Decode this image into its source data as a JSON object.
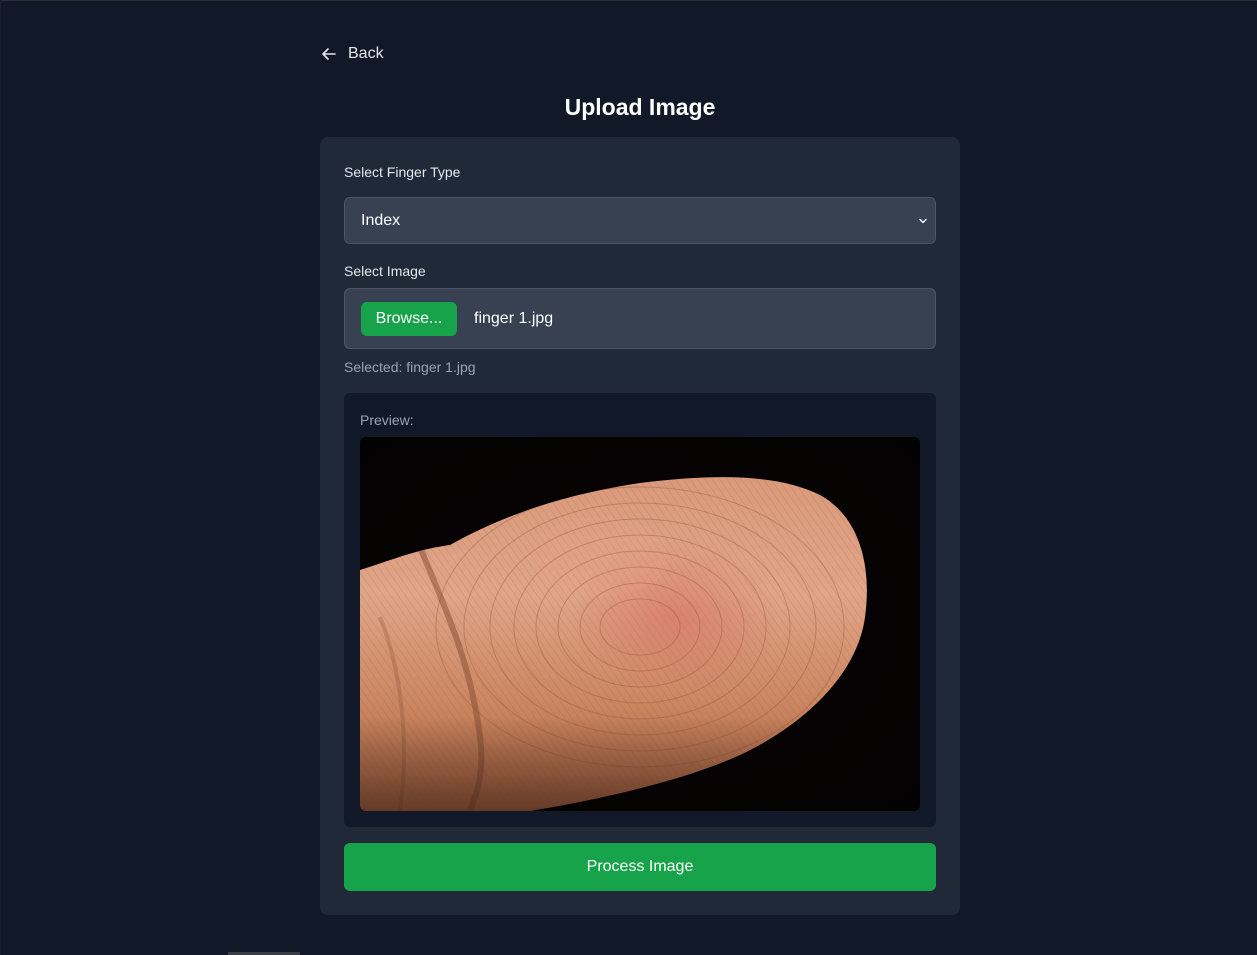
{
  "nav": {
    "back_label": "Back",
    "back_icon": "arrow-left-icon"
  },
  "page": {
    "title": "Upload Image"
  },
  "form": {
    "finger_type_label": "Select Finger Type",
    "finger_type_value": "Index",
    "select_icon": "chevron-down-icon",
    "image_label": "Select Image",
    "browse_label": "Browse...",
    "file_name": "finger 1.jpg",
    "selected_text": "Selected: finger 1.jpg",
    "preview_label": "Preview:",
    "process_label": "Process Image"
  },
  "colors": {
    "background": "#111827",
    "card": "#1f2937",
    "input": "#374151",
    "accent_green": "#16a34a"
  }
}
